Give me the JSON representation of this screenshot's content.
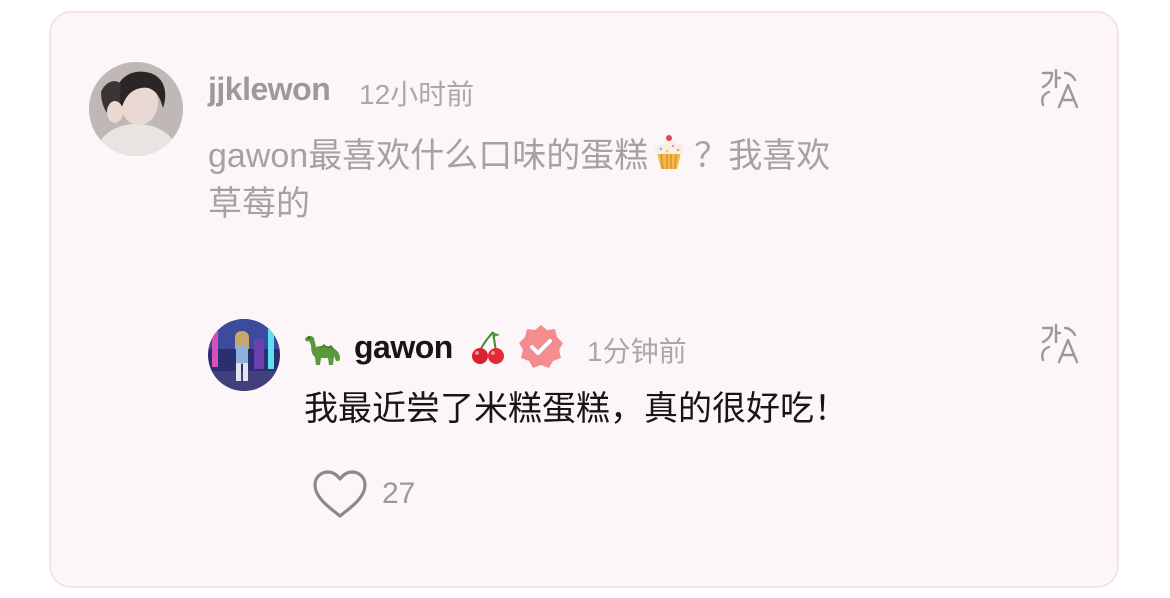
{
  "comment": {
    "username": "jjklewon",
    "time": "12小时前",
    "text_part1": "gawon最喜欢什么口味的蛋糕",
    "emoji": "cupcake",
    "text_part2": "？我喜欢",
    "text_line2": "草莓的"
  },
  "reply": {
    "prefix_emoji": "sauropod",
    "username": "gawon",
    "suffix_emoji": "cherries",
    "verified": true,
    "time": "1分钟前",
    "text": "我最近尝了米糕蛋糕，真的很好吃！",
    "likes": "27"
  },
  "icons": {
    "translate": "translate-icon",
    "like": "heart-outline-icon",
    "verified": "verified-badge-icon"
  },
  "colors": {
    "card_bg": "#fdf6f8",
    "card_border": "#f5e3e8",
    "verified": "#f48d8d",
    "muted_text": "#9a9a9a"
  }
}
